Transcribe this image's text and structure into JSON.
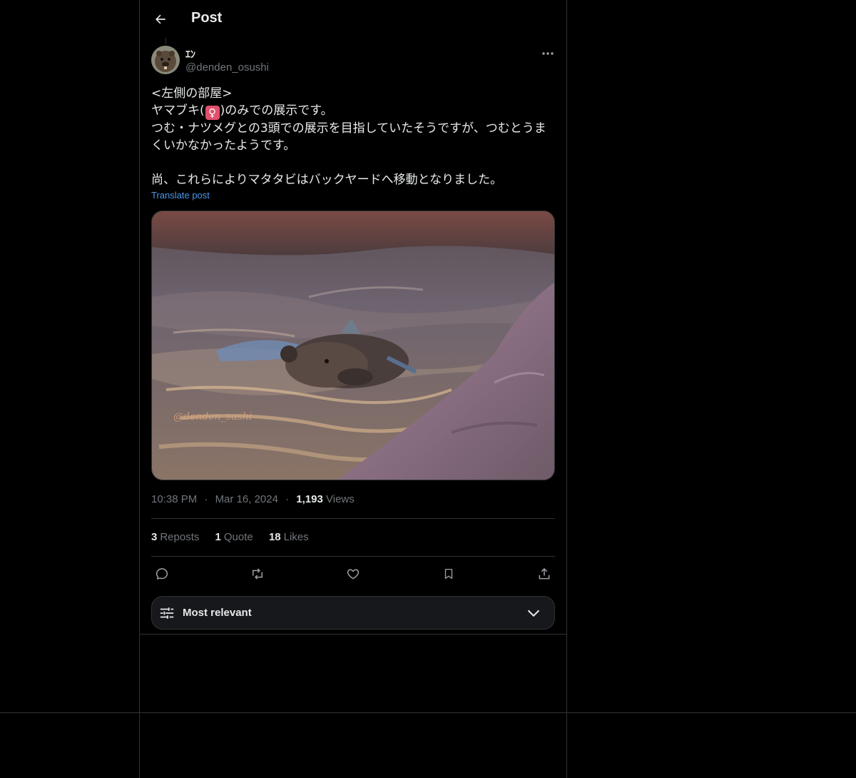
{
  "header": {
    "title": "Post"
  },
  "author": {
    "display_name": "ｴﾝ",
    "handle": "@denden_osushi"
  },
  "post": {
    "lines": [
      "<左側の部屋>",
      "ヤマブキ(",
      ")のみでの展示です。",
      "つむ・ナツメグとの3頭での展示を目指していたそうですが、つむとうま",
      "くいかなかったようです。",
      "",
      "尚、これらによりマタタビはバックヤードへ移動となりました。"
    ],
    "female_symbol": "♀",
    "translate_label": "Translate post",
    "image_watermark": "@denden_sushi"
  },
  "meta": {
    "time": "10:38 PM",
    "separator": "·",
    "date": "Mar 16, 2024",
    "views_count": "1,193",
    "views_label": "Views"
  },
  "stats": {
    "reposts_count": "3",
    "reposts_label": "Reposts",
    "quotes_count": "1",
    "quotes_label": "Quote",
    "likes_count": "18",
    "likes_label": "Likes"
  },
  "sort": {
    "label": "Most relevant"
  },
  "icons": {
    "back": "arrow-left-icon",
    "more": "more-horizontal-icon",
    "reply": "reply-icon",
    "repost": "repost-icon",
    "like": "heart-icon",
    "bookmark": "bookmark-icon",
    "share": "share-icon",
    "sort": "sliders-icon",
    "chevron": "chevron-down-icon"
  },
  "colors": {
    "background": "#000000",
    "text_primary": "#e7e9ea",
    "text_secondary": "#71767b",
    "link": "#4a99e9",
    "border": "#2f3336",
    "sort_bar_bg": "#16181c"
  }
}
